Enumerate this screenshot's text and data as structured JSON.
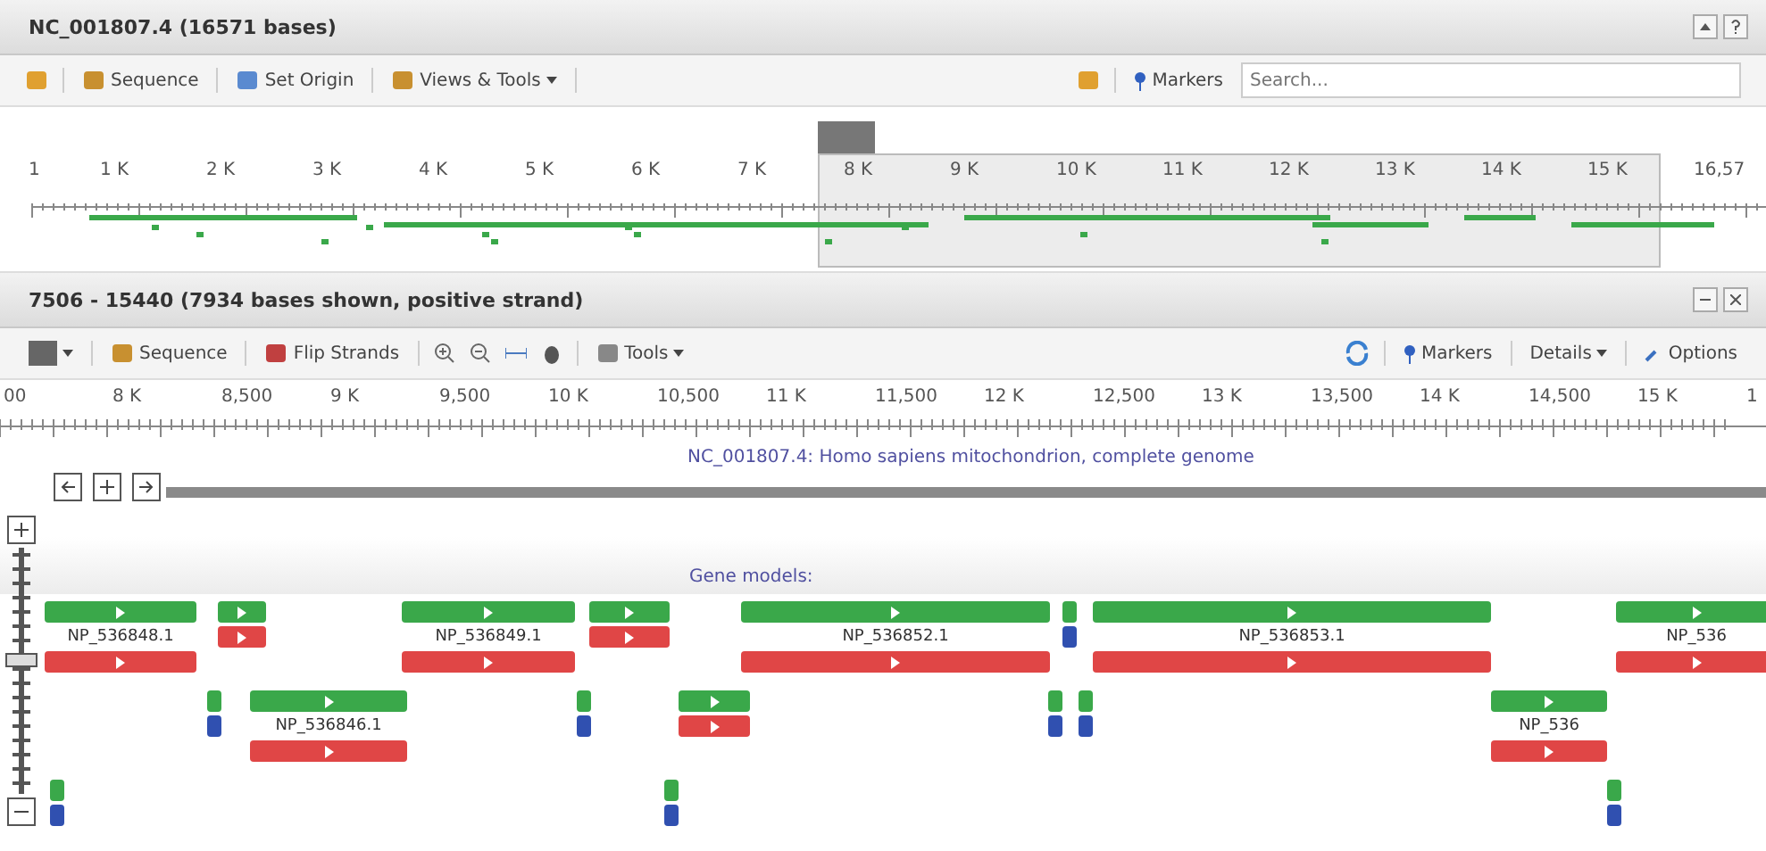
{
  "overview_panel": {
    "title": "NC_001807.4 (16571 bases)",
    "toolbar": {
      "left": [
        "Sequence",
        "Set Origin",
        "Views & Tools"
      ],
      "markers": "Markers",
      "search": {
        "placeholder": "Search..."
      }
    },
    "ruler": [
      "1",
      "1 K",
      "2 K",
      "3 K",
      "4 K",
      "5 K",
      "6 K",
      "7 K",
      "8 K",
      "9 K",
      "10 K",
      "11 K",
      "12 K",
      "13 K",
      "14 K",
      "15 K",
      "16,57"
    ]
  },
  "detail_panel": {
    "title": "7506 - 15440 (7934 bases shown, positive strand)",
    "toolbar": {
      "left": [
        "Sequence",
        "Flip Strands",
        "Tools"
      ],
      "markers": "Markers",
      "details": "Details",
      "options": "Options"
    },
    "ruler": [
      "00",
      "8 K",
      "8,500",
      "9 K",
      "9,500",
      "10 K",
      "10,500",
      "11 K",
      "11,500",
      "12 K",
      "12,500",
      "13 K",
      "13,500",
      "14 K",
      "14,500",
      "15 K",
      "1"
    ],
    "sequence_title": "NC_001807.4: Homo sapiens mitochondrion, complete genome",
    "zoom": {
      "level": 0.55
    },
    "track_title": "Gene models:",
    "features": [
      {
        "kind": "gene",
        "label": "NP_536848.1"
      },
      {
        "kind": "gene"
      },
      {
        "kind": "gene",
        "label": "NP_536849.1"
      },
      {
        "kind": "gene"
      },
      {
        "kind": "gene",
        "label": "NP_536852.1"
      },
      {
        "kind": "marker"
      },
      {
        "kind": "gene",
        "label": "NP_536853.1"
      },
      {
        "kind": "gene",
        "label": "NP_536"
      },
      {
        "kind": "marker"
      },
      {
        "kind": "gene",
        "label": "NP_536846.1"
      },
      {
        "kind": "marker"
      },
      {
        "kind": "gene"
      },
      {
        "kind": "marker"
      },
      {
        "kind": "marker"
      },
      {
        "kind": "gene",
        "label": "NP_536"
      },
      {
        "kind": "marker"
      },
      {
        "kind": "marker"
      },
      {
        "kind": "marker"
      }
    ]
  }
}
